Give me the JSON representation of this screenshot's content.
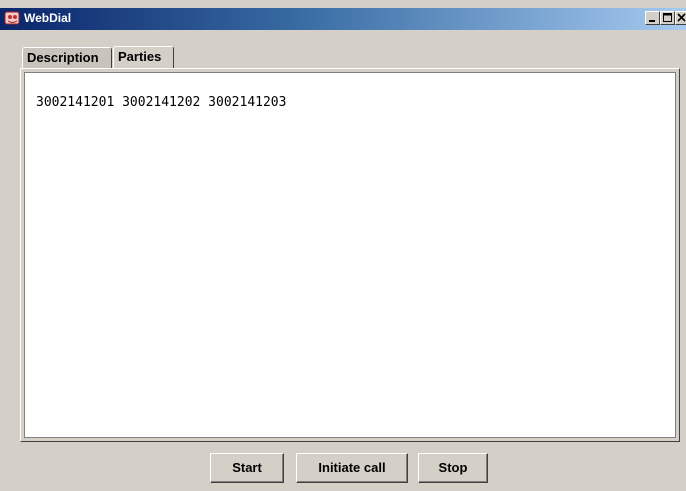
{
  "window": {
    "title": "WebDial",
    "icon": "webdial-app-icon",
    "controls": [
      "minimize-icon",
      "maximize-icon",
      "close-icon"
    ]
  },
  "tabs": [
    {
      "label": "Description",
      "selected": false
    },
    {
      "label": "Parties",
      "selected": true
    }
  ],
  "parties_text": "3002141201 3002141202 3002141203",
  "buttons": {
    "start": "Start",
    "initiate_call": "Initiate call",
    "stop": "Stop"
  }
}
